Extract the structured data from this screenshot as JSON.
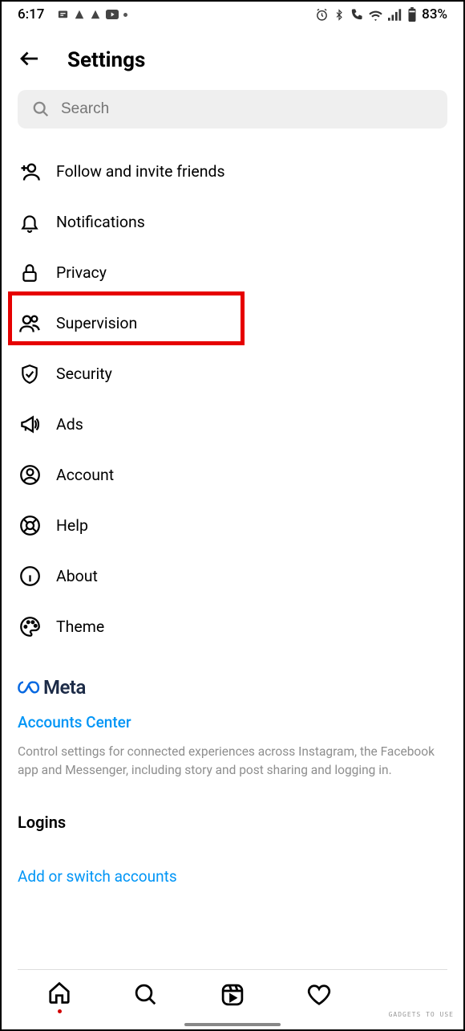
{
  "statusbar": {
    "time": "6:17",
    "battery": "83%"
  },
  "header": {
    "title": "Settings"
  },
  "search": {
    "placeholder": "Search"
  },
  "items": [
    {
      "label": "Follow and invite friends"
    },
    {
      "label": "Notifications"
    },
    {
      "label": "Privacy"
    },
    {
      "label": "Supervision"
    },
    {
      "label": "Security"
    },
    {
      "label": "Ads"
    },
    {
      "label": "Account"
    },
    {
      "label": "Help"
    },
    {
      "label": "About"
    },
    {
      "label": "Theme"
    }
  ],
  "meta": {
    "brand": "Meta",
    "accounts_center": "Accounts Center",
    "description": "Control settings for connected experiences across Instagram, the Facebook app and Messenger, including story and post sharing and logging in."
  },
  "logins": {
    "title": "Logins",
    "add_switch": "Add or switch accounts"
  },
  "watermark": "GADGETS TO USE"
}
